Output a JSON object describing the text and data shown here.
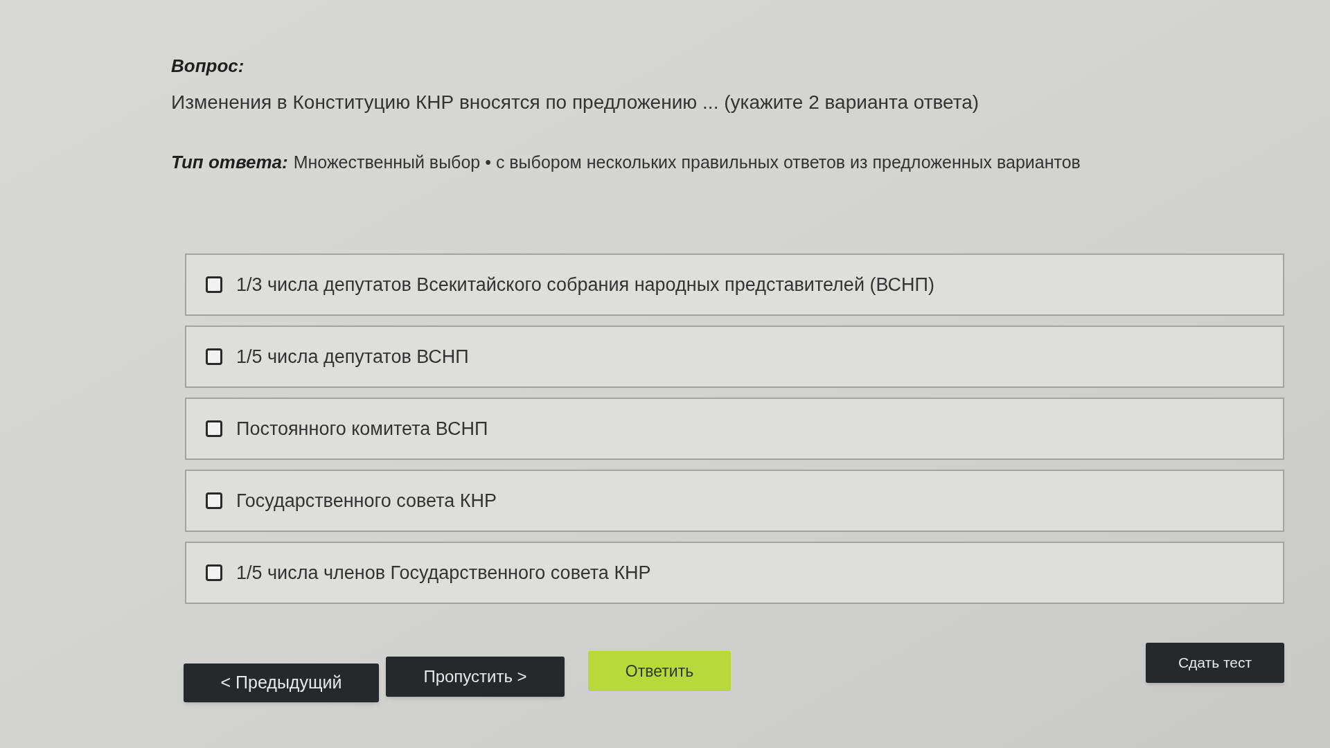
{
  "question": {
    "label": "Вопрос:",
    "text": "Изменения в Конституцию КНР вносятся по предложению ... (укажите 2 варианта ответа)"
  },
  "answer_type": {
    "label": "Тип ответа:",
    "text": "Множественный выбор • с выбором нескольких правильных ответов из предложенных вариантов"
  },
  "options": [
    {
      "text": "1/3 числа депутатов Всекитайского собрания народных представителей (ВСНП)",
      "checked": false
    },
    {
      "text": "1/5 числа депутатов ВСНП",
      "checked": false
    },
    {
      "text": "Постоянного комитета ВСНП",
      "checked": false
    },
    {
      "text": "Государственного совета КНР",
      "checked": false
    },
    {
      "text": "1/5 числа членов Государственного совета КНР",
      "checked": false
    }
  ],
  "buttons": [
    {
      "label": "< Предыдущий",
      "kind": "dark"
    },
    {
      "label": "Пропустить >",
      "kind": "dark"
    },
    {
      "label": "Ответить",
      "kind": "accent"
    }
  ],
  "finish_button": {
    "label": "Сдать тест",
    "kind": "dark"
  }
}
